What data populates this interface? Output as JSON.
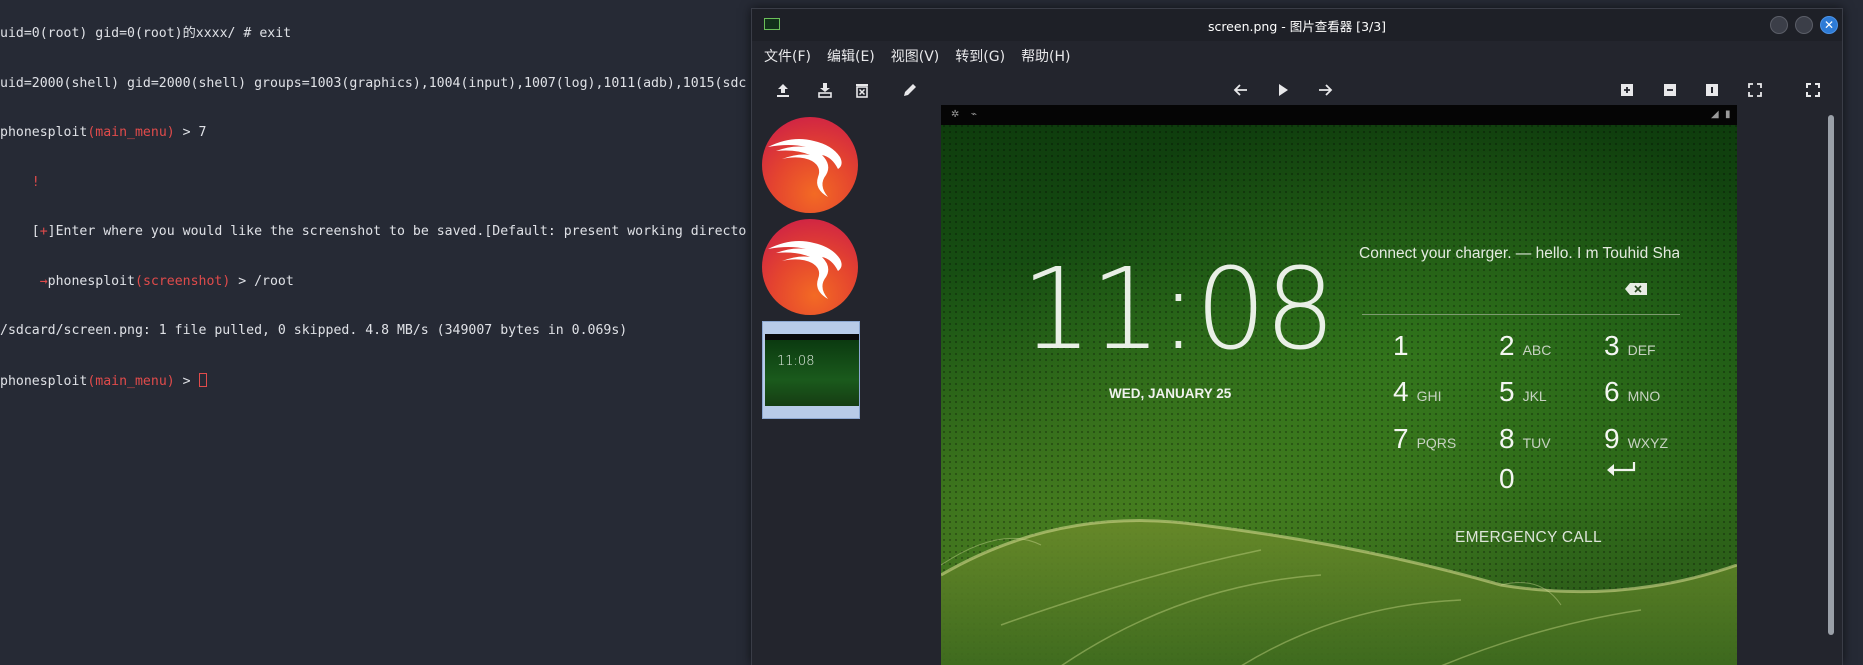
{
  "terminal": {
    "lines": [
      {
        "text": "uid=0(root) gid=0(root)的xxxx/ # exit"
      },
      {
        "text": "uid=2000(shell) gid=2000(shell) groups=1003(graphics),1004(input),1007(log),1011(adb),1015(sdc"
      },
      {
        "prompt": "phonesploit",
        "ctx": "main_menu",
        "cmd": " > 7"
      },
      {
        "bang": "    !"
      },
      {
        "pre": "    [",
        "sym": "+",
        "post": "]Enter where you would like the screenshot to be saved.[Default: present working directo"
      },
      {
        "arrow": "     →",
        "prompt": "phonesploit",
        "ctx": "screenshot",
        "cmd": " > /root"
      },
      {
        "text": "/sdcard/screen.png: 1 file pulled, 0 skipped. 4.8 MB/s (349007 bytes in 0.069s)"
      },
      {
        "prompt": "phonesploit",
        "ctx": "main_menu",
        "cmd": " > "
      }
    ]
  },
  "viewer": {
    "title": "screen.png - 图片查看器 [3/3]",
    "menus": [
      "文件(F)",
      "编辑(E)",
      "视图(V)",
      "转到(G)",
      "帮助(H)"
    ],
    "toolbar_icons": [
      "upload-icon",
      "save-icon",
      "delete-icon",
      "edit-icon",
      "back-icon",
      "play-icon",
      "forward-icon",
      "zoom-in-icon",
      "zoom-out-icon",
      "zoom-100-icon",
      "fit-icon",
      "fullscreen-icon"
    ],
    "thumbnails": [
      {
        "kind": "kali-logo"
      },
      {
        "kind": "kali-logo"
      },
      {
        "kind": "screenshot",
        "time": "11:08",
        "selected": true
      }
    ],
    "image": {
      "clock": "11:08",
      "date": "WED, JANUARY 25",
      "owner_info": "Connect your charger. — hello. I m Touhid Shai",
      "keys": [
        {
          "digit": "1",
          "letters": ""
        },
        {
          "digit": "2",
          "letters": "ABC"
        },
        {
          "digit": "3",
          "letters": "DEF"
        },
        {
          "digit": "4",
          "letters": "GHI"
        },
        {
          "digit": "5",
          "letters": "JKL"
        },
        {
          "digit": "6",
          "letters": "MNO"
        },
        {
          "digit": "7",
          "letters": "PQRS"
        },
        {
          "digit": "8",
          "letters": "TUV"
        },
        {
          "digit": "9",
          "letters": "WXYZ"
        },
        {
          "digit": "0",
          "letters": ""
        }
      ],
      "emergency": "EMERGENCY CALL"
    }
  }
}
